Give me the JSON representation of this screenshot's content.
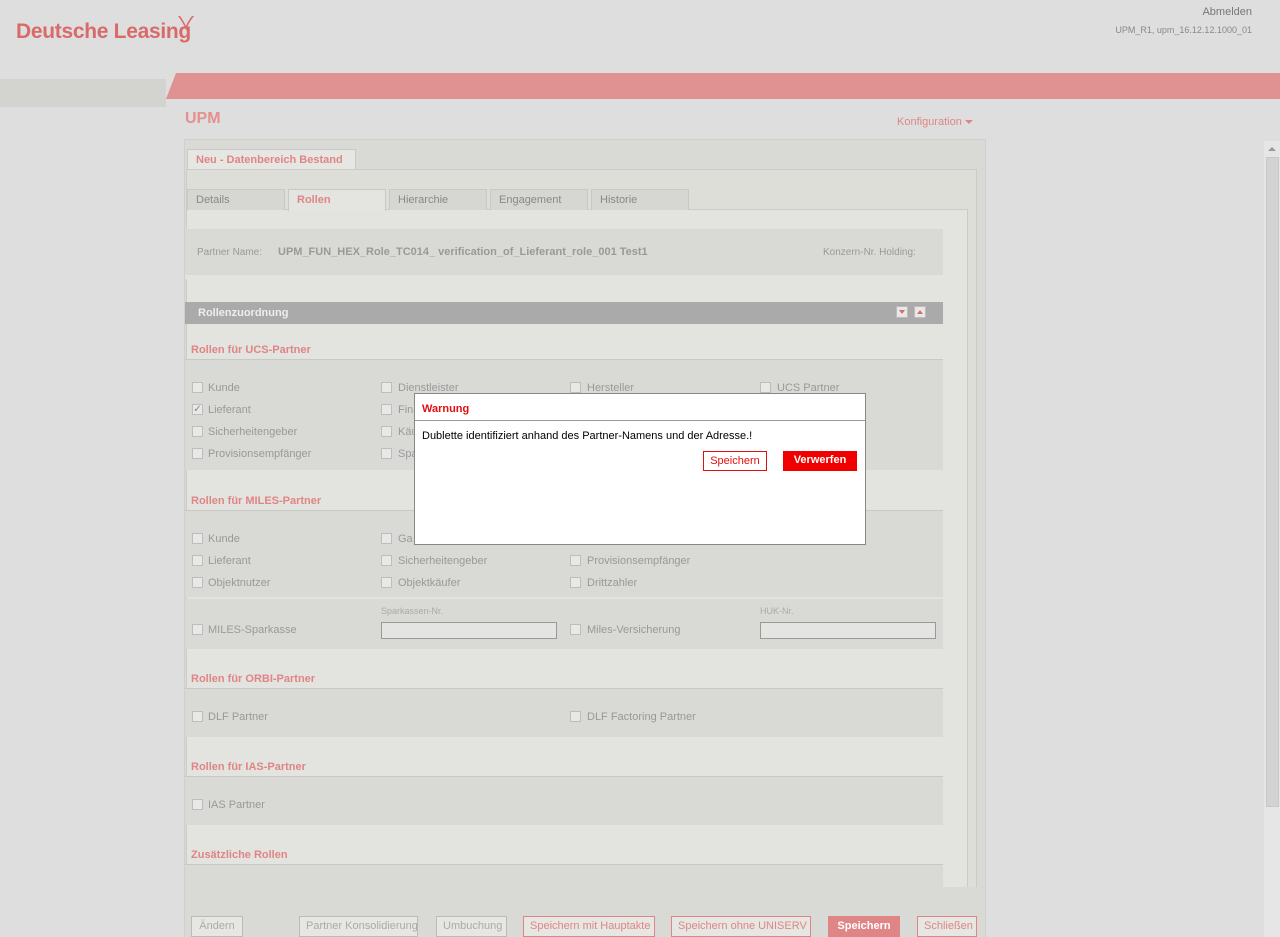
{
  "header": {
    "logo": "Deutsche Leasing",
    "logout": "Abmelden",
    "user_info": "UPM_R1, upm_16.12.12.1000_01"
  },
  "app": {
    "title": "UPM",
    "config": "Konfiguration"
  },
  "main_tab": "Neu - Datenbereich Bestand",
  "sub_tabs": [
    "Details",
    "Rollen",
    "Hierarchie",
    "Engagement",
    "Historie"
  ],
  "partner": {
    "name_label": "Partner Name:",
    "name_value": "UPM_FUN_HEX_Role_TC014_ verification_of_Lieferant_role_001 Test1",
    "konzern_label": "Konzern-Nr. Holding:"
  },
  "rollen": {
    "header": "Rollenzuordnung",
    "ucs": {
      "title": "Rollen für UCS-Partner",
      "items": [
        "Kunde",
        "Dienstleister",
        "Hersteller",
        "UCS Partner",
        "Lieferant",
        "Fina",
        "Sicherheitengeber",
        "Käu",
        "Provisionsempfänger",
        "Spa"
      ]
    },
    "miles": {
      "title": "Rollen für MILES-Partner",
      "items": [
        "Kunde",
        "Ga",
        "Lieferant",
        "Sicherheitengeber",
        "Provisionsempfänger",
        "Objektnutzer",
        "Objektkäufer",
        "Drittzahler"
      ],
      "sparkasse": "MILES-Sparkasse",
      "sparkassen_nr_label": "Sparkassen-Nr.",
      "versicherung": "Miles-Versicherung",
      "huk_label": "HUK-Nr."
    },
    "orbi": {
      "title": "Rollen für ORBI-Partner",
      "items": [
        "DLF Partner",
        "DLF Factoring Partner"
      ]
    },
    "ias": {
      "title": "Rollen für IAS-Partner",
      "items": [
        "IAS Partner"
      ]
    },
    "extra": {
      "title": "Zusätzliche Rollen"
    }
  },
  "footer": {
    "aendern": "Ändern",
    "partner_konsolidierung": "Partner Konsolidierung",
    "umbuchung": "Umbuchung",
    "speichern_hauptakte": "Speichern mit Hauptakte",
    "speichern_ohne_uniserv": "Speichern ohne UNISERV",
    "speichern": "Speichern",
    "schliessen": "Schließen"
  },
  "dialog": {
    "title": "Warnung",
    "message": "Dublette identifiziert anhand des Partner-Namens und der Adresse.!",
    "save": "Speichern",
    "discard": "Verwerfen"
  },
  "colors": {
    "brand": "#e08585",
    "warning": "#e01010",
    "discard_bg": "#f00000"
  }
}
